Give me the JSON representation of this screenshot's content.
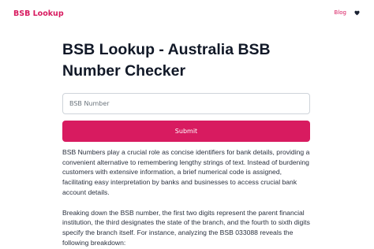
{
  "header": {
    "brand": "BSB Lookup",
    "nav_blog": "Blog",
    "heart_icon": "heart-icon"
  },
  "main": {
    "title": "BSB Lookup - Australia BSB Number Checker",
    "search": {
      "placeholder": "BSB Number",
      "value": ""
    },
    "submit_label": "Submit",
    "paragraphs": [
      "BSB Numbers play a crucial role as concise identifiers for bank details, providing a convenient alternative to remembering lengthy strings of text. Instead of burdening customers with extensive information, a brief numerical code is assigned, facilitating easy interpretation by banks and businesses to access crucial bank account details.",
      "Breaking down the BSB number, the first two digits represent the parent financial institution, the third designates the state of the branch, and the fourth to sixth digits specify the branch itself. For instance, analyzing the BSB 033088 reveals the following breakdown:"
    ]
  },
  "colors": {
    "accent": "#d81b60",
    "text": "#2b3240",
    "heading": "#111827",
    "input_border": "#cfd4da"
  }
}
